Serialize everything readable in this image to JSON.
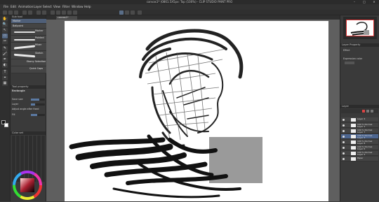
{
  "titlebar": {
    "title": "canvas1* (0861.5X5px: Top (100%) - CLIP STUDIO PAINT PRO"
  },
  "menu": [
    "File",
    "Edit",
    "Animation",
    "Layer",
    "Select",
    "View",
    "Filter",
    "Window",
    "Help"
  ],
  "canvas_tab": "canvas1*",
  "subtool": {
    "header": "Sub tool",
    "brushes": [
      "Marker",
      "",
      "Ballpoint",
      "",
      "Gradient",
      "",
      "Marker pen",
      "Fine",
      ""
    ],
    "brush_labels_right": [
      "Marker",
      "Pointed",
      "Mixer",
      "Sketch",
      "Quick Caps"
    ],
    "misc_labels": [
      "Ebony Selection",
      "Quick Caps"
    ],
    "tool_property_header": "Tool property",
    "property_title": "Rectangle",
    "properties": [
      "Save size",
      "Layer",
      "Adjust angle after fixed",
      "Fill"
    ],
    "sliders": [
      0.6,
      0.3,
      0.45,
      0.5
    ],
    "lower_header": "Color set"
  },
  "left_tools": [
    "✋",
    "🔍",
    "↖",
    "▭",
    "✂",
    "✎",
    "🖌",
    "✒",
    "◐",
    "T",
    "⌖",
    "▦"
  ],
  "right": {
    "nav_header": "Navigator",
    "panel_labels": [
      "Layer Property",
      "Effect",
      "Expression color",
      "Color"
    ],
    "layers_header": "Layer",
    "layers": [
      {
        "name": "Layer 4",
        "active": false
      },
      {
        "name": "100 % Normal Layer 1",
        "active": false
      },
      {
        "name": "100 % Normal Layer 7",
        "active": false
      },
      {
        "name": "100 % Normal Layer 3",
        "active": true
      },
      {
        "name": "100 % Normal Layer 8",
        "active": false
      },
      {
        "name": "100 % Normal Layer 6",
        "active": false
      },
      {
        "name": "100 % Normal Layer 2",
        "active": false
      },
      {
        "name": "Paper",
        "active": false
      }
    ]
  },
  "colors": {
    "accent": "#4d6690",
    "paper": "#ffffff",
    "gray_rect": "#9a9a9a"
  }
}
